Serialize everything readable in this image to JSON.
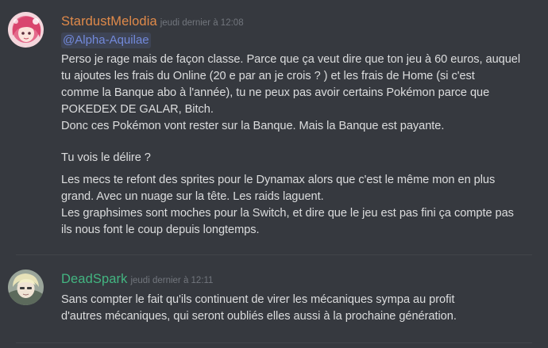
{
  "colors": {
    "background": "#36393f",
    "message_text": "#dcddde",
    "timestamp": "#72767d",
    "mention_text": "#7289da",
    "user1_name": "#e08a4a",
    "user2_name": "#43b581"
  },
  "messages": [
    {
      "username": "StardustMelodia",
      "timestamp": "jeudi dernier à 12:08",
      "avatar_icon": "pink-hair-avatar",
      "mention": "@Alpha-Aquilae",
      "lines": [
        "Perso je rage mais de façon classe. Parce que ça veut dire que ton jeu à 60 euros, auquel",
        "tu ajoutes les frais du Online (20 e par an je crois ? ) et les frais de Home (si c'est",
        "comme la Banque abo à l'année), tu ne peux pas avoir certains Pokémon parce que",
        "POKEDEX DE GALAR, Bitch.",
        "Donc ces Pokémon vont rester sur la Banque. Mais la Banque est payante.",
        "Tu vois le délire ?",
        "Les mecs te refont des sprites pour le Dynamax alors que c'est le même mon en plus",
        "grand. Avec un nuage sur la tête. Les raids laguent.",
        "Les graphsimes sont moches pour la Switch, et dire que le jeu est pas fini ça compte pas",
        "ils nous font le coup depuis longtemps."
      ]
    },
    {
      "username": "DeadSpark",
      "timestamp": "jeudi dernier à 12:11",
      "avatar_icon": "blonde-hair-avatar",
      "lines": [
        "Sans compter le fait qu'ils continuent de virer les mécaniques sympa au profit",
        "d'autres mécaniques, qui seront oubliés elles aussi à la prochaine génération."
      ]
    }
  ]
}
